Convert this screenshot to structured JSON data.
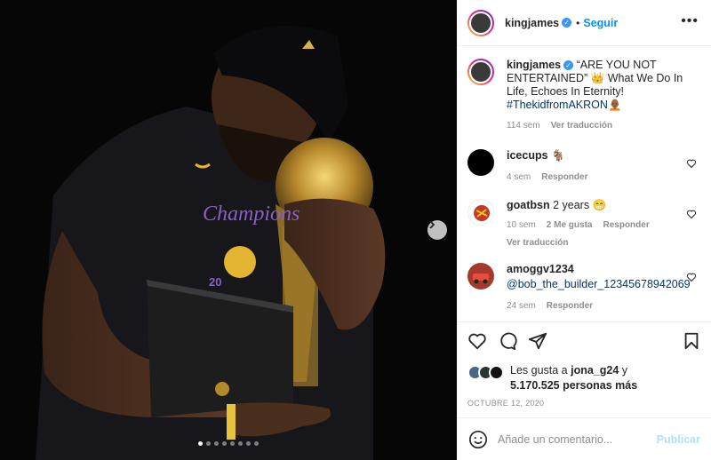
{
  "post": {
    "image_alt": "King James kissing the championship trophy",
    "carousel": {
      "total": 8,
      "active": 0
    }
  },
  "header": {
    "username": "kingjames",
    "follow_label": "Seguir",
    "more_label": "•••"
  },
  "caption": {
    "username": "kingjames",
    "text": "“ARE YOU NOT ENTERTAINED” 👑  What We Do In Life, Echoes In Eternity! ",
    "hashtag": "#ThekidfromAKRON",
    "emoji": "🧑🏾‍🦲",
    "age": "114 sem",
    "translate": "Ver traducción"
  },
  "comments": [
    {
      "username": "icecups",
      "text": "🐐",
      "age": "4 sem",
      "reply": "Responder",
      "avatar_color": "#000000"
    },
    {
      "username": "goatbsn",
      "text": "2 years 😁",
      "age": "10 sem",
      "likes": "2 Me gusta",
      "reply": "Responder",
      "translate": "Ver traducción",
      "avatar_color": "#c0392b"
    },
    {
      "username": "amoggv1234",
      "mention": "@bob_the_builder_12345678942069",
      "age": "24 sem",
      "reply": "Responder",
      "avatar_color": "#a33a2b"
    }
  ],
  "likes": {
    "prefix": "Les gusta a ",
    "user": "jona_g24",
    "suffix": " y",
    "count": "5.170.525 personas más"
  },
  "date": "OCTUBRE 12, 2020",
  "add_comment": {
    "placeholder": "Añade un comentario...",
    "publish_label": "Publicar"
  },
  "colors": {
    "accent": "#0095f6",
    "verified": "#3897f0",
    "publish_disabled": "#b2dffc"
  }
}
